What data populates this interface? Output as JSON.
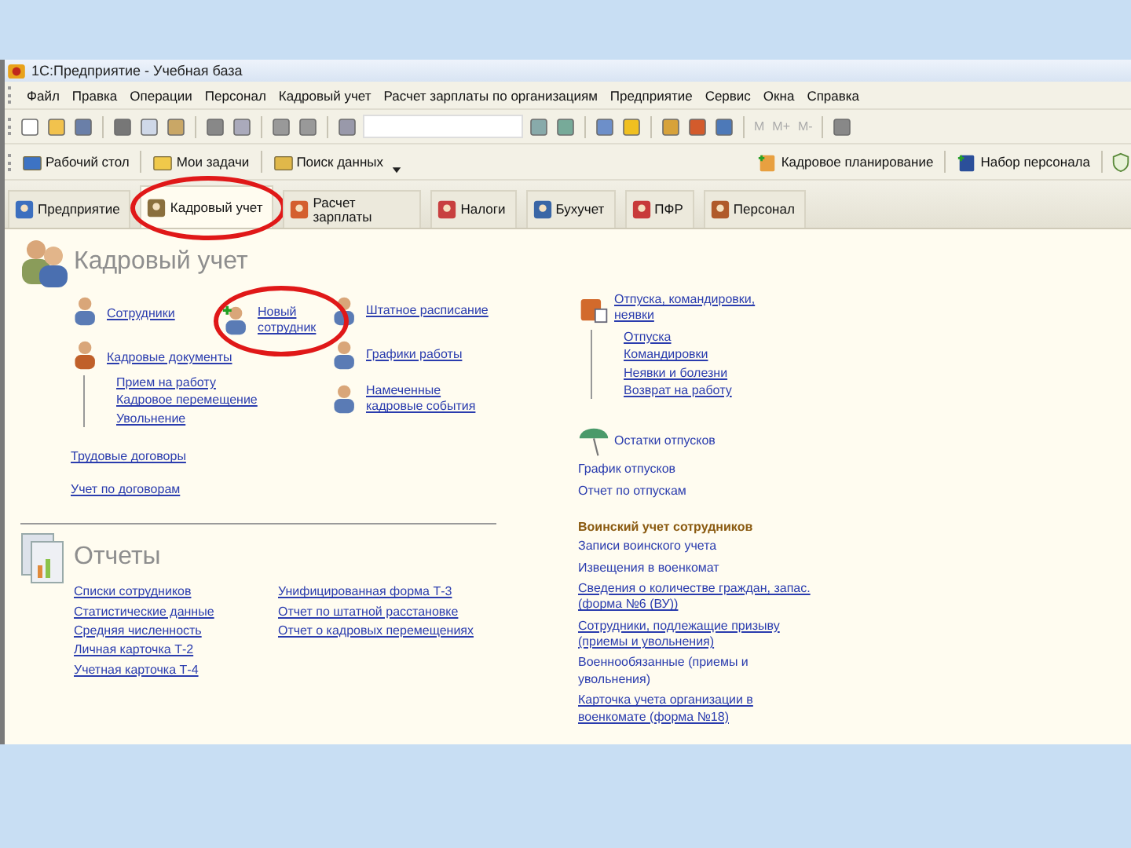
{
  "window": {
    "title": "1С:Предприятие - Учебная база"
  },
  "menu": [
    "Файл",
    "Правка",
    "Операции",
    "Персонал",
    "Кадровый учет",
    "Расчет зарплаты по организациям",
    "Предприятие",
    "Сервис",
    "Окна",
    "Справка"
  ],
  "memory_buttons": [
    {
      "label": "M",
      "disabled": true
    },
    {
      "label": "M+",
      "disabled": true
    },
    {
      "label": "M-",
      "disabled": true
    }
  ],
  "quick_bar": {
    "left": [
      "Рабочий стол",
      "Мои задачи",
      "Поиск данных"
    ],
    "right": [
      "Кадровое планирование",
      "Набор персонала"
    ]
  },
  "tabs": [
    {
      "label": "Предприятие",
      "selected": false,
      "circled": false
    },
    {
      "label": "Кадровый учет",
      "selected": true,
      "circled": true
    },
    {
      "label": "Расчет зарплаты",
      "selected": false,
      "circled": false
    },
    {
      "label": "Налоги",
      "selected": false,
      "circled": false
    },
    {
      "label": "Бухучет",
      "selected": false,
      "circled": false
    },
    {
      "label": "ПФР",
      "selected": false,
      "circled": false
    },
    {
      "label": "Персонал",
      "selected": false,
      "circled": false
    }
  ],
  "hr_section": {
    "title": "Кадровый учет",
    "column_1": [
      {
        "kind": "icon_link",
        "label": "Сотрудники",
        "circled": false
      },
      {
        "kind": "icon_link",
        "label": "Кадровые документы",
        "circled": false,
        "children": [
          "Прием на работу",
          "Кадровое перемещение",
          "Увольнение"
        ]
      },
      {
        "kind": "link",
        "label": "Трудовые договоры",
        "circled": false
      },
      {
        "kind": "link",
        "label": "Учет по договорам",
        "circled": false
      }
    ],
    "column_2": [
      {
        "kind": "icon_link",
        "label": "Новый сотрудник",
        "circled": true
      }
    ],
    "column_3": [
      {
        "kind": "icon_link",
        "label": "Штатное расписание",
        "circled": false
      },
      {
        "kind": "icon_link",
        "label": "Графики работы",
        "circled": false
      },
      {
        "kind": "icon_link",
        "label": "Намеченные кадровые события",
        "circled": false
      }
    ]
  },
  "right_column": [
    {
      "kind": "icon_link",
      "label": "Отпуска, командировки, неявки",
      "children": [
        "Отпуска",
        "Командировки",
        "Неявки и болезни",
        "Возврат на работу"
      ]
    },
    {
      "kind": "icon_text",
      "label": "Остатки отпусков"
    },
    {
      "kind": "text",
      "label": "График отпусков"
    },
    {
      "kind": "text",
      "label": "Отчет по отпускам"
    },
    {
      "kind": "heading",
      "label": "Воинский учет сотрудников"
    },
    {
      "kind": "text",
      "label": "Записи воинского учета"
    },
    {
      "kind": "text",
      "label": "Извещения в военкомат"
    },
    {
      "kind": "link",
      "label": "Сведения о количестве граждан, запас. (форма №6 (ВУ))"
    },
    {
      "kind": "link",
      "label": "Сотрудники, подлежащие призыву (приемы и увольнения)"
    },
    {
      "kind": "text",
      "label": "Военнообязанные (приемы и увольнения)"
    },
    {
      "kind": "link",
      "label": "Карточка учета организации в военкомате (форма №18)"
    }
  ],
  "reports": {
    "title": "Отчеты",
    "column_1": [
      "Списки сотрудников",
      "Статистические данные",
      "Средняя численность",
      "Личная карточка Т-2",
      "Учетная карточка Т-4"
    ],
    "column_2": [
      "Унифицированная форма Т-3",
      "Отчет по штатной расстановке",
      "Отчет о кадровых перемещениях"
    ]
  }
}
